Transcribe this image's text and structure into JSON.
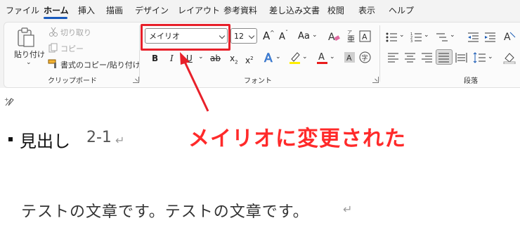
{
  "menu": {
    "tabs": [
      "ファイル",
      "ホーム",
      "挿入",
      "描画",
      "デザイン",
      "レイアウト",
      "参考資料",
      "差し込み文書",
      "校閲",
      "表示",
      "ヘルプ"
    ],
    "active_tab": "ホーム"
  },
  "clipboard": {
    "paste_label": "貼り付け",
    "cut_label": "切り取り",
    "copy_label": "コピー",
    "format_painter_label": "書式のコピー/貼り付け",
    "group_label": "クリップボード"
  },
  "font": {
    "font_name": "メイリオ",
    "font_size": "12",
    "grow_label": "A",
    "shrink_label": "A",
    "case_label": "Aa",
    "bold": "B",
    "italic": "I",
    "underline": "U",
    "strike": "ab",
    "subscript": "x",
    "superscript": "x",
    "group_label": "フォント"
  },
  "paragraph": {
    "group_label": "段落"
  },
  "document": {
    "heading": "見出し",
    "heading_number": "2-1",
    "body": "テストの文章です。テストの文章です。"
  },
  "annotation": {
    "text": "メイリオに変更された",
    "color": "#ff2a2a"
  },
  "colors": {
    "accent": "#185abd",
    "highlight_border": "#e8202a"
  }
}
